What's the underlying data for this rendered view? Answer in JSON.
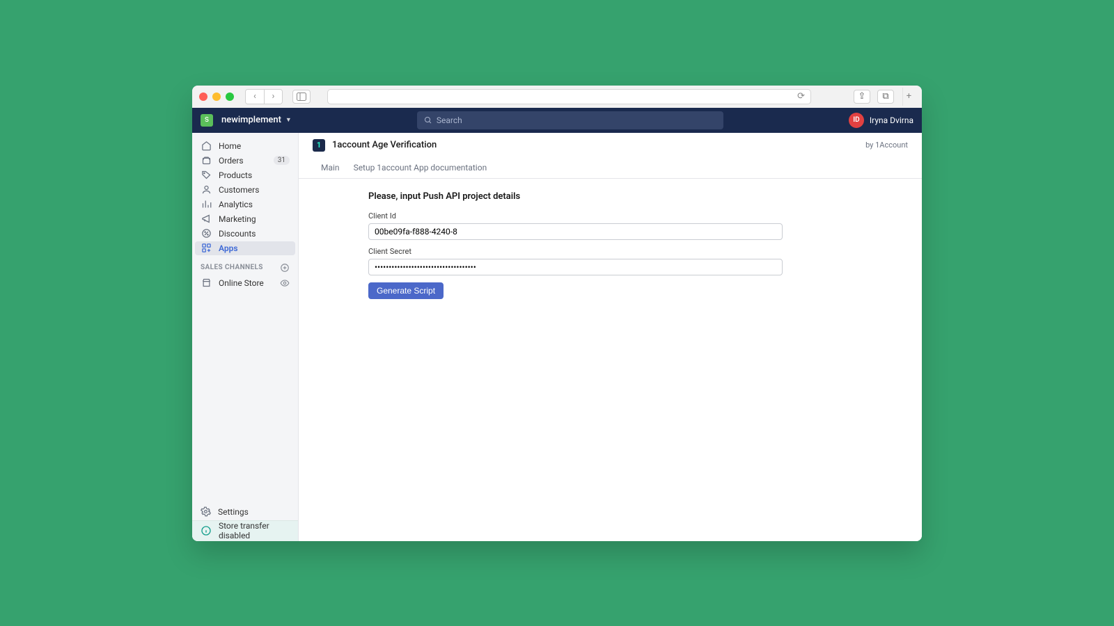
{
  "browser": {
    "refresh_glyph": "⟳",
    "share_glyph": "⇪",
    "tabs_glyph": "⧉",
    "plus_glyph": "+",
    "back_glyph": "‹",
    "fwd_glyph": "›"
  },
  "header": {
    "store_name": "newimplement",
    "search_placeholder": "Search",
    "user_initials": "ID",
    "user_name": "Iryna Dvirna"
  },
  "sidebar": {
    "items": [
      {
        "key": "home",
        "label": "Home"
      },
      {
        "key": "orders",
        "label": "Orders",
        "badge": "31"
      },
      {
        "key": "products",
        "label": "Products"
      },
      {
        "key": "customers",
        "label": "Customers"
      },
      {
        "key": "analytics",
        "label": "Analytics"
      },
      {
        "key": "marketing",
        "label": "Marketing"
      },
      {
        "key": "discounts",
        "label": "Discounts"
      },
      {
        "key": "apps",
        "label": "Apps",
        "active": true
      }
    ],
    "channels_label": "SALES CHANNELS",
    "channels": [
      {
        "key": "online-store",
        "label": "Online Store"
      }
    ],
    "settings_label": "Settings",
    "disabled_label": "Store transfer disabled"
  },
  "app": {
    "icon_glyph": "1",
    "title": "1account Age Verification",
    "by_label": "by 1Account",
    "tabs": {
      "main": "Main",
      "setup": "Setup 1account App documentation"
    },
    "heading": "Please, input Push API project details",
    "client_id_label": "Client Id",
    "client_id_value": "00be09fa-f888-4240-8",
    "client_secret_label": "Client Secret",
    "client_secret_value": "••••••••••••••••••••••••••••••••••••",
    "button_label": "Generate Script"
  }
}
